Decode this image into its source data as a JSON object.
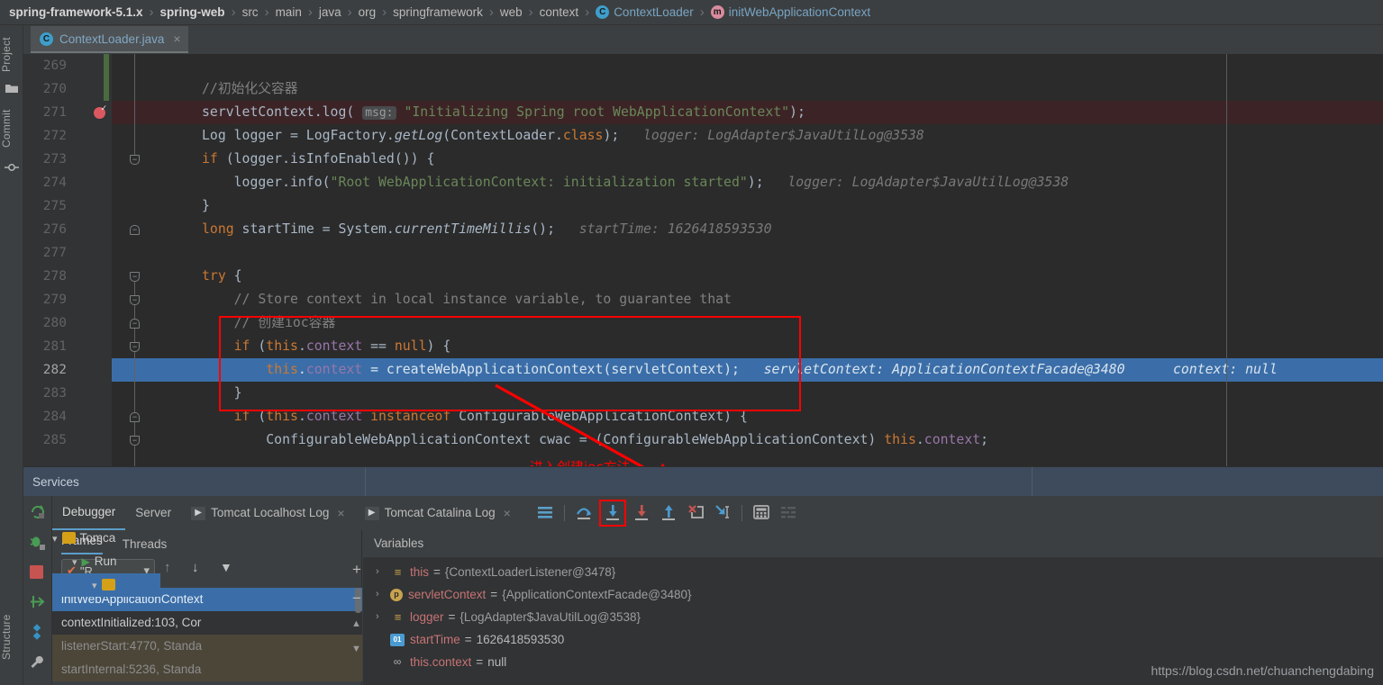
{
  "breadcrumb": {
    "items": [
      {
        "label": "spring-framework-5.1.x",
        "style": "bold",
        "icon": null
      },
      {
        "label": "spring-web",
        "style": "bold",
        "icon": null
      },
      {
        "label": "src",
        "style": "plain",
        "icon": null
      },
      {
        "label": "main",
        "style": "plain",
        "icon": null
      },
      {
        "label": "java",
        "style": "plain",
        "icon": null
      },
      {
        "label": "org",
        "style": "plain",
        "icon": null
      },
      {
        "label": "springframework",
        "style": "plain",
        "icon": null
      },
      {
        "label": "web",
        "style": "plain",
        "icon": null
      },
      {
        "label": "context",
        "style": "plain",
        "icon": null
      },
      {
        "label": "ContextLoader",
        "style": "link",
        "icon": "class-icon",
        "icon_letter": "C"
      },
      {
        "label": "initWebApplicationContext",
        "style": "link",
        "icon": "method-icon",
        "icon_letter": "m"
      }
    ],
    "separator": "›"
  },
  "toolstrip": {
    "project_label": "Project",
    "commit_label": "Commit",
    "structure_label": "Structure"
  },
  "editor_tab": {
    "label": "ContextLoader.java",
    "icon_letter": "C",
    "close": "×"
  },
  "editor": {
    "first_line": 269,
    "breakpoint_line": 271,
    "current_line": 282,
    "lines": [
      {
        "n": 269,
        "html": "",
        "state": "modified"
      },
      {
        "n": 270,
        "html": "<span class=\"cmt\">//初始化父容器</span>",
        "state": "modified"
      },
      {
        "n": 271,
        "html": "<span class=\"mth\">servletContext</span>.<span class=\"mth\">log</span>( <span class=\"paramhint\">msg:</span> <span class=\"str\">\"Initializing Spring root WebApplicationContext\"</span>);",
        "state": "breakpoint"
      },
      {
        "n": 272,
        "html": "Log logger = LogFactory.<span class=\"sfld\">getLog</span>(ContextLoader.<span class=\"kw\">class</span>);",
        "hint": "logger: LogAdapter$JavaUtilLog@3538",
        "state": "normal"
      },
      {
        "n": 273,
        "html": "<span class=\"kw\">if</span> (logger.isInfoEnabled()) {",
        "state": "normal"
      },
      {
        "n": 274,
        "html": "    logger.info(<span class=\"str\">\"Root WebApplicationContext: initialization started\"</span>);",
        "hint": "logger: LogAdapter$JavaUtilLog@3538",
        "state": "normal"
      },
      {
        "n": 275,
        "html": "}",
        "state": "normal"
      },
      {
        "n": 276,
        "html": "<span class=\"kw\">long</span> startTime = System.<span class=\"sfld\">currentTimeMillis</span>();",
        "hint": "startTime: 1626418593530",
        "state": "normal"
      },
      {
        "n": 277,
        "html": "",
        "state": "normal"
      },
      {
        "n": 278,
        "html": "<span class=\"kw\">try</span> {",
        "state": "normal"
      },
      {
        "n": 279,
        "html": "    <span class=\"cmt\">// Store context in local instance variable, to guarantee that</span>",
        "state": "normal"
      },
      {
        "n": 280,
        "html": "    <span class=\"cmt\">// 创建ioc容器</span>",
        "state": "normal"
      },
      {
        "n": 281,
        "html": "    <span class=\"kw\">if</span> (<span class=\"kw\">this</span>.<span class=\"fld\">context</span> == <span class=\"kw\">null</span>) {",
        "state": "normal"
      },
      {
        "n": 282,
        "html": "        <span class=\"kw\">this</span>.<span class=\"fld\">context</span> = createWebApplicationContext(servletContext);",
        "hint": "servletContext: ApplicationContextFacade@3480      context: null",
        "state": "executing"
      },
      {
        "n": 283,
        "html": "    }",
        "state": "normal"
      },
      {
        "n": 284,
        "html": "    <span class=\"kw\">if</span> (<span class=\"kw\">this</span>.<span class=\"fld\">context</span> <span class=\"kw\">instanceof</span> ConfigurableWebApplicationContext) {",
        "state": "normal"
      },
      {
        "n": 285,
        "html": "        ConfigurableWebApplicationContext cwac = (ConfigurableWebApplicationContext) <span class=\"kw\">this</span>.<span class=\"fld\">context</span>;",
        "state": "normal"
      }
    ]
  },
  "annotation": {
    "red_note": "进入创建ioc方法"
  },
  "services_bar": {
    "title": "Services"
  },
  "debug_toolbar": {
    "tabs": [
      {
        "label": "Debugger",
        "active": true,
        "icon": null,
        "closable": false
      },
      {
        "label": "Server",
        "active": false,
        "icon": null,
        "closable": false
      },
      {
        "label": "Tomcat Localhost Log",
        "active": false,
        "icon": "console-icon",
        "closable": true
      },
      {
        "label": "Tomcat Catalina Log",
        "active": false,
        "icon": "console-icon",
        "closable": true
      }
    ],
    "close_glyph": "×",
    "actions": [
      {
        "name": "show-execution-point-icon",
        "highlighted": false
      },
      {
        "name": "step-over-icon",
        "highlighted": false
      },
      {
        "name": "step-into-icon",
        "highlighted": true
      },
      {
        "name": "force-step-into-icon",
        "highlighted": false
      },
      {
        "name": "step-out-icon",
        "highlighted": false
      },
      {
        "name": "drop-frame-icon",
        "highlighted": false
      },
      {
        "name": "run-to-cursor-icon",
        "highlighted": false
      },
      {
        "name": "evaluate-expression-icon",
        "highlighted": false
      },
      {
        "name": "mute-breakpoints-icon",
        "highlighted": false
      }
    ]
  },
  "services_tree": {
    "items": [
      {
        "label": "Tomca",
        "icon": "tomcat-icon",
        "indent": 0,
        "selected": false
      },
      {
        "label": "Run",
        "icon": "run-icon",
        "indent": 1,
        "selected": false
      },
      {
        "label": "",
        "icon": "tomcat-running-icon",
        "indent": 2,
        "selected": true
      }
    ]
  },
  "frames_pane": {
    "tabs": [
      {
        "label": "Frames",
        "active": true
      },
      {
        "label": "Threads",
        "active": false
      }
    ],
    "thread_selector": {
      "value": "\"R...",
      "check": "✔",
      "chevron": "▾"
    },
    "nav": {
      "up": "↑",
      "down": "↓",
      "filter": "▼"
    },
    "items": [
      {
        "label": "initWebApplicationContext",
        "type": "selected"
      },
      {
        "label": "contextInitialized:103, Cor",
        "type": "user"
      },
      {
        "label": "listenerStart:4770, Standa",
        "type": "library"
      },
      {
        "label": "startInternal:5236, Standa",
        "type": "library"
      }
    ]
  },
  "variables_pane": {
    "header": "Variables",
    "buttons": {
      "add": "+",
      "remove": "−",
      "up": "▲",
      "down": "▼"
    },
    "rows": [
      {
        "arrow": "›",
        "icon": "field-icon",
        "icon_text": "≡",
        "name": "this",
        "value": "{ContextLoaderListener@3478}",
        "value_kind": "ref"
      },
      {
        "arrow": "›",
        "icon": "parameter-icon",
        "icon_text": "p",
        "name": "servletContext",
        "value": "{ApplicationContextFacade@3480}",
        "value_kind": "ref"
      },
      {
        "arrow": "›",
        "icon": "field-icon",
        "icon_text": "≡",
        "name": "logger",
        "value": "{LogAdapter$JavaUtilLog@3538}",
        "value_kind": "ref"
      },
      {
        "arrow": "",
        "icon": "primitive-icon",
        "icon_text": "01",
        "name": "startTime",
        "value": "1626418593530",
        "value_kind": "num"
      },
      {
        "arrow": "",
        "icon": "null-icon",
        "icon_text": "∞",
        "name": "this.context",
        "value": "null",
        "value_kind": "num"
      }
    ]
  },
  "watermark": {
    "text": "https://blog.csdn.net/chuanchengdabing"
  },
  "colors": {
    "editor_bg": "#2b2b2b",
    "gutter_bg": "#313335",
    "panel_bg": "#3c3f41",
    "selection_blue": "#3b6ea8",
    "breakpoint_row": "#3c2426",
    "services_bar": "#3d4b5c",
    "annotation_red": "#fe0000",
    "keyword": "#cc7832",
    "string": "#6a8759",
    "field": "#9876aa",
    "comment": "#808080",
    "text": "#a9b7c6"
  }
}
